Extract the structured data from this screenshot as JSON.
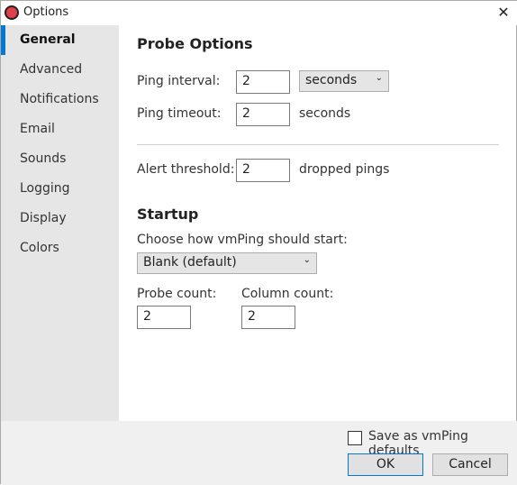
{
  "window": {
    "title": "Options",
    "close": "✕"
  },
  "sidebar": {
    "items": [
      {
        "label": "General",
        "selected": true
      },
      {
        "label": "Advanced"
      },
      {
        "label": "Notifications"
      },
      {
        "label": "Email"
      },
      {
        "label": "Sounds"
      },
      {
        "label": "Logging"
      },
      {
        "label": "Display"
      },
      {
        "label": "Colors"
      }
    ]
  },
  "probe": {
    "heading": "Probe Options",
    "ping_interval_label": "Ping interval:",
    "ping_interval_value": "2",
    "ping_interval_unit": "seconds",
    "ping_timeout_label": "Ping timeout:",
    "ping_timeout_value": "2",
    "ping_timeout_unit": "seconds",
    "alert_label": "Alert threshold:",
    "alert_value": "2",
    "alert_unit": "dropped pings"
  },
  "startup": {
    "heading": "Startup",
    "choose_label": "Choose how vmPing should start:",
    "mode": "Blank (default)",
    "probe_count_label": "Probe count:",
    "probe_count": "2",
    "column_count_label": "Column count:",
    "column_count": "2"
  },
  "footer": {
    "save_defaults_label": "Save as vmPing defaults",
    "save_defaults_checked": false,
    "ok": "OK",
    "cancel": "Cancel"
  },
  "colors": {
    "accent": "#0078d4"
  }
}
